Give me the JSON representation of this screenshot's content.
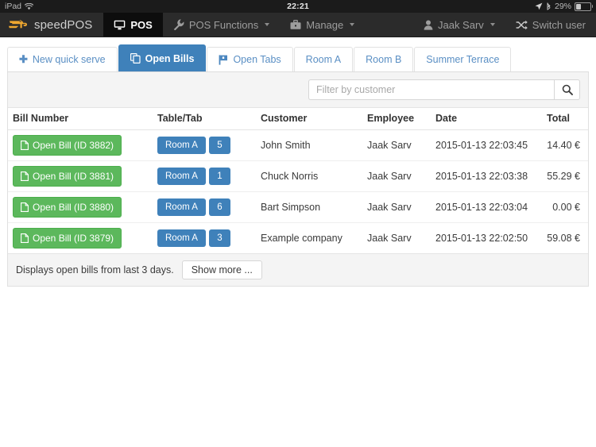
{
  "status_bar": {
    "device": "iPad",
    "wifi_icon": "wifi-icon",
    "time": "22:21",
    "location_icon": "location-arrow-icon",
    "bluetooth_icon": "bluetooth-icon",
    "battery_percent": "29%"
  },
  "navbar": {
    "brand": "speedPOS",
    "brand_icon": "speedpos-logo-icon",
    "items": [
      {
        "label": "POS",
        "icon": "desktop-icon",
        "active": true,
        "caret": false
      },
      {
        "label": "POS Functions",
        "icon": "wrench-icon",
        "active": false,
        "caret": true
      },
      {
        "label": "Manage",
        "icon": "briefcase-icon",
        "active": false,
        "caret": true
      }
    ],
    "user": {
      "label": "Jaak Sarv",
      "icon": "user-icon",
      "caret": true
    },
    "switch_user": {
      "label": "Switch user",
      "icon": "shuffle-icon"
    }
  },
  "tabs": [
    {
      "label": "New quick serve",
      "icon": "plus-icon",
      "active": false
    },
    {
      "label": "Open Bills",
      "icon": "copy-files-icon",
      "active": true
    },
    {
      "label": "Open Tabs",
      "icon": "flag-icon",
      "active": false
    },
    {
      "label": "Room A",
      "icon": "",
      "active": false
    },
    {
      "label": "Room B",
      "icon": "",
      "active": false
    },
    {
      "label": "Summer Terrace",
      "icon": "",
      "active": false
    }
  ],
  "search": {
    "placeholder": "Filter by customer",
    "value": "",
    "button_icon": "search-icon"
  },
  "table": {
    "headers": {
      "bill_number": "Bill Number",
      "table_tab": "Table/Tab",
      "customer": "Customer",
      "employee": "Employee",
      "date": "Date",
      "total": "Total"
    },
    "rows": [
      {
        "bill_button": "Open Bill (ID 3882)",
        "bill_icon": "file-icon",
        "room": "Room A",
        "seat": "5",
        "customer": "John Smith",
        "employee": "Jaak Sarv",
        "date": "2015-01-13 22:03:45",
        "total": "14.40 €"
      },
      {
        "bill_button": "Open Bill (ID 3881)",
        "bill_icon": "file-icon",
        "room": "Room A",
        "seat": "1",
        "customer": "Chuck Norris",
        "employee": "Jaak Sarv",
        "date": "2015-01-13 22:03:38",
        "total": "55.29 €"
      },
      {
        "bill_button": "Open Bill (ID 3880)",
        "bill_icon": "file-icon",
        "room": "Room A",
        "seat": "6",
        "customer": "Bart Simpson",
        "employee": "Jaak Sarv",
        "date": "2015-01-13 22:03:04",
        "total": "0.00 €"
      },
      {
        "bill_button": "Open Bill (ID 3879)",
        "bill_icon": "file-icon",
        "room": "Room A",
        "seat": "3",
        "customer": "Example company",
        "employee": "Jaak Sarv",
        "date": "2015-01-13 22:02:50",
        "total": "59.08 €"
      }
    ]
  },
  "footer": {
    "note": "Displays open bills from last 3 days.",
    "show_more_label": "Show more ..."
  },
  "colors": {
    "brand_orange": "#f0a830",
    "navbar_bg": "#2b2b2b",
    "active_tab_blue": "#3f81ba",
    "open_bill_green": "#5cb85c",
    "tag_blue": "#3f81ba",
    "panel_head_bg": "#f4f4f4"
  }
}
